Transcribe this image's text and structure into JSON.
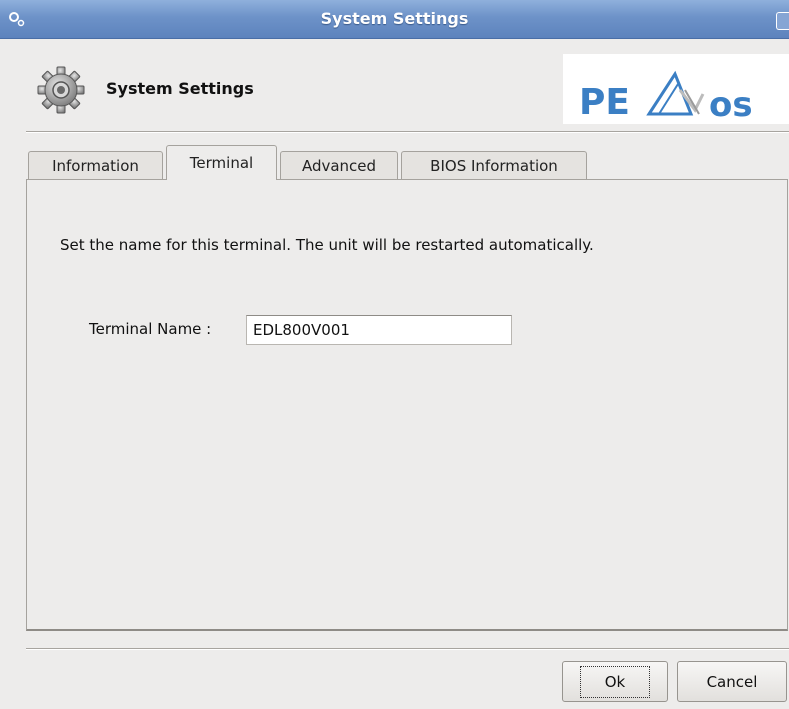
{
  "window": {
    "title": "System Settings"
  },
  "header": {
    "title": "System Settings",
    "logo_text": "PEAKos"
  },
  "tabs": [
    {
      "label": "Information",
      "active": false
    },
    {
      "label": "Terminal",
      "active": true
    },
    {
      "label": "Advanced",
      "active": false
    },
    {
      "label": "BIOS Information",
      "active": false
    }
  ],
  "terminal_tab": {
    "description": "Set the name for this terminal. The unit will be restarted automatically.",
    "name_label": "Terminal Name :",
    "name_value": "EDL800V001"
  },
  "buttons": {
    "ok": "Ok",
    "cancel": "Cancel"
  },
  "colors": {
    "titlebar": "#6d92c8",
    "dialog_bg": "#edeceb",
    "logo_blue": "#3b7fc4"
  }
}
